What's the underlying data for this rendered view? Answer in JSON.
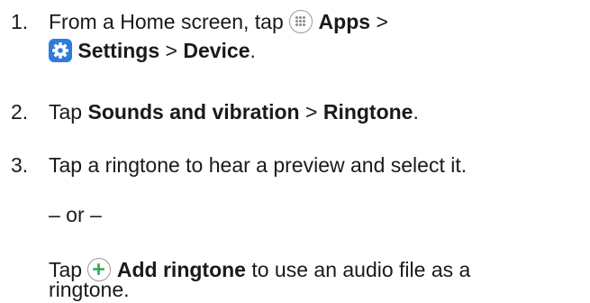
{
  "steps": [
    {
      "number": "1.",
      "line1": {
        "prefix": "From a Home screen, tap",
        "apps": "Apps",
        "sep1": ">"
      },
      "line2": {
        "settings": "Settings",
        "sep2": ">",
        "device": "Device",
        "period": "."
      },
      "icons": [
        "apps-icon",
        "settings-icon"
      ]
    },
    {
      "number": "2.",
      "prefix": "Tap",
      "sounds": "Sounds and vibration",
      "sep": ">",
      "ringtone": "Ringtone",
      "period": "."
    },
    {
      "number": "3.",
      "text": "Tap a ringtone to hear a preview and select it.",
      "or": "– or –",
      "alt_prefix": "Tap",
      "add_ringtone": "Add ringtone",
      "alt_rest1": "to use an audio file as a",
      "alt_rest2": "ringtone.",
      "icons": [
        "plus-icon"
      ]
    }
  ],
  "colors": {
    "text": "#1a1a1a",
    "settings_icon_bg": "#2f7bdc",
    "plus_green": "#2fa84f",
    "icon_border": "#9a9a9a"
  }
}
